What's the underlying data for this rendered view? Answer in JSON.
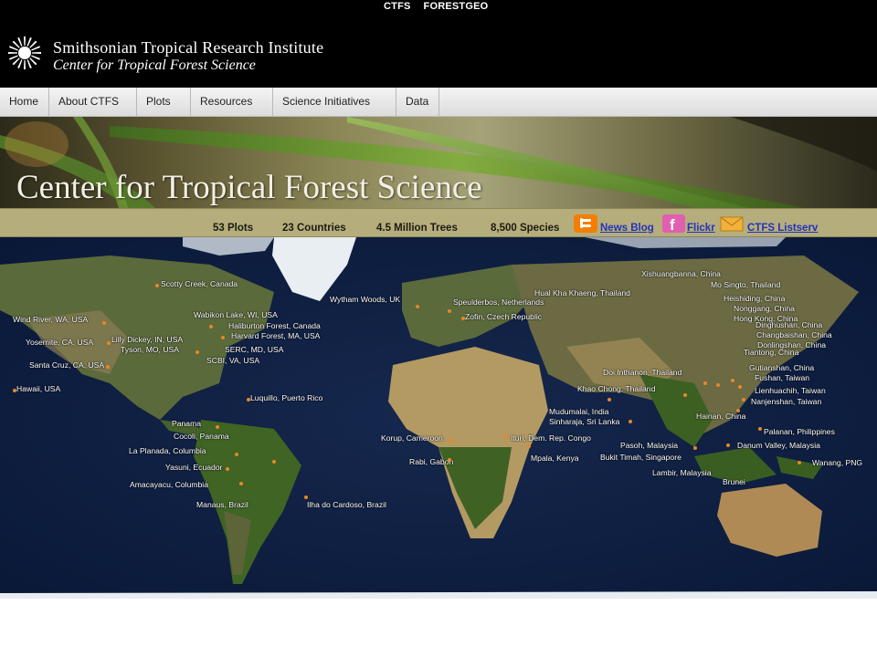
{
  "top_links": [
    "CTFS",
    "FORESTGEO"
  ],
  "institute": {
    "name": "Smithsonian Tropical Research Institute",
    "subtitle": "Center for Tropical Forest Science"
  },
  "nav": [
    "Home",
    "About CTFS",
    "Plots",
    "Resources",
    "Science Initiatives",
    "Data"
  ],
  "banner_title": "Center for Tropical Forest Science",
  "stats": {
    "plots": "53 Plots",
    "countries": "23 Countries",
    "trees": "4.5 Million Trees",
    "species": "8,500 Species"
  },
  "social": {
    "blog": "News Blog",
    "flickr": "Flickr",
    "listserv": "CTFS Listserv"
  },
  "colors": {
    "blogger": "#f57d00",
    "flickr": "#e05fb0",
    "mail": "#f2b23a",
    "site_dot": "#e8872a"
  },
  "map_sites": [
    "Scotty Creek, Canada",
    "Wind River, WA, USA",
    "Yosemite, CA, USA",
    "Santa Cruz, CA, USA",
    "Hawaii, USA",
    "Lilly Dickey, IN, USA",
    "Tyson, MO, USA",
    "Wabikon Lake, WI, USA",
    "Haliburton Forest, Canada",
    "Harvard Forest, MA, USA",
    "SERC, MD, USA",
    "SCBI, VA, USA",
    "Luquillo, Puerto Rico",
    "Wytham Woods, UK",
    "Speulderbos, Netherlands",
    "Zofin, Czech Republic",
    "Panama",
    "Cocoli, Panama",
    "La Planada, Columbia",
    "Yasuni, Ecuador",
    "Amacayacu, Columbia",
    "Manaus, Brazil",
    "Ilha do Cardoso, Brazil",
    "Korup, Cameroon",
    "Rabi, Gabon",
    "Ituri, Dem. Rep. Congo",
    "Mpala, Kenya",
    "Mudumalai, India",
    "Sinharaja, Sri Lanka",
    "Hual Kha Khaeng, Thailand",
    "Mo Singto, Thailand",
    "Doi Inthanon, Thailand",
    "Khao Chong, Thailand",
    "Pasoh, Malaysia",
    "Bukit Timah, Singapore",
    "Lambir, Malaysia",
    "Brunei",
    "Xishuangbanna, China",
    "Heishiding, China",
    "Nonggang, China",
    "Hong Kong, China",
    "Dinghushan, China",
    "Changbaishan, China",
    "Donlingshan, China",
    "Tiantong, China",
    "Gutianshan, China",
    "Fushan, Taiwan",
    "Lienhuachih, Taiwan",
    "Nanjenshan, Taiwan",
    "Hainan, China",
    "Palanan, Philippines",
    "Danum Valley, Malaysia",
    "Wanang, PNG"
  ]
}
